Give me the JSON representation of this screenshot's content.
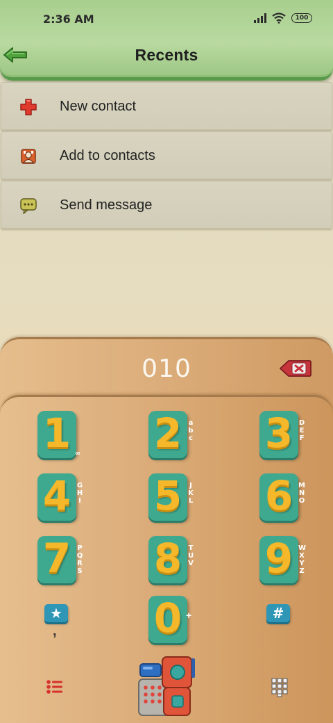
{
  "status_bar": {
    "time": "2:36 AM",
    "battery": "100"
  },
  "header": {
    "title": "Recents",
    "back_icon": "green-arrow-left-icon"
  },
  "menu": {
    "items": [
      {
        "label": "New contact",
        "icon": "red-plus-icon"
      },
      {
        "label": "Add to contacts",
        "icon": "contact-card-icon"
      },
      {
        "label": "Send message",
        "icon": "message-bubble-icon"
      }
    ]
  },
  "dialer": {
    "number": "010",
    "keys": [
      {
        "digit": "1",
        "letters": "∞"
      },
      {
        "digit": "2",
        "letters": "abc"
      },
      {
        "digit": "3",
        "letters": "DEF"
      },
      {
        "digit": "4",
        "letters": "GHI"
      },
      {
        "digit": "5",
        "letters": "JKL"
      },
      {
        "digit": "6",
        "letters": "MNO"
      },
      {
        "digit": "7",
        "letters": "PQRS"
      },
      {
        "digit": "8",
        "letters": "TUV"
      },
      {
        "digit": "9",
        "letters": "WXYZ"
      },
      {
        "digit": "0",
        "letters": "+"
      }
    ],
    "star_key": "★",
    "star_sub": ",",
    "hash_key": "#"
  },
  "colors": {
    "header_green": "#a8cf8e",
    "key_teal": "#3fa98f",
    "digit_yellow": "#f5b82a",
    "panel_tan": "#dcae7b"
  }
}
